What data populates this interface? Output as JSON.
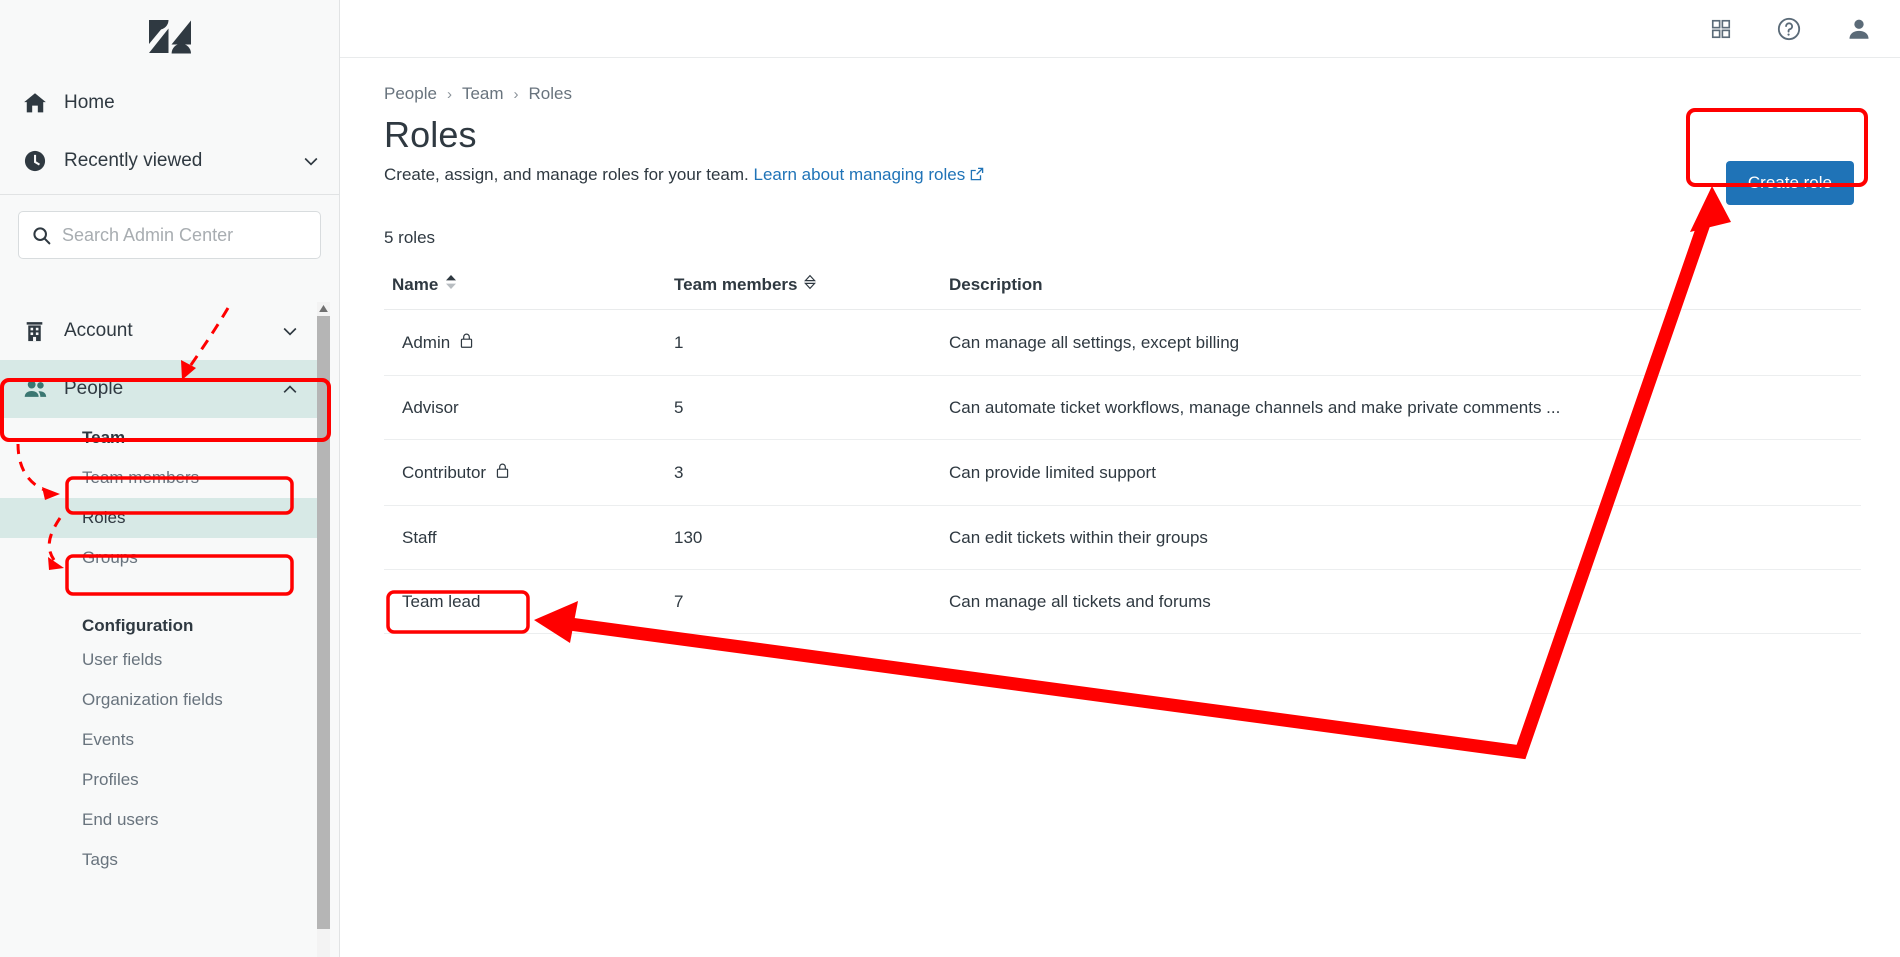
{
  "brand": {
    "logo_icon": "zendesk-logo"
  },
  "sidebar": {
    "top_items": [
      {
        "label": "Home",
        "icon": "home-icon",
        "chevron": false
      },
      {
        "label": "Recently viewed",
        "icon": "clock-icon",
        "chevron": true
      }
    ],
    "search": {
      "placeholder": "Search Admin Center",
      "value": "",
      "icon": "search-icon"
    },
    "sections": [
      {
        "label": "Account",
        "icon": "building-icon",
        "expanded": false,
        "active": false
      },
      {
        "label": "People",
        "icon": "people-icon",
        "expanded": true,
        "active": true
      }
    ],
    "people_children": [
      {
        "label": "Team",
        "style": "bold",
        "active": false
      },
      {
        "label": "Team members",
        "style": "normal",
        "active": false
      },
      {
        "label": "Roles",
        "style": "normal",
        "active": true
      },
      {
        "label": "Groups",
        "style": "normal",
        "active": false
      }
    ],
    "configuration_heading": "Configuration",
    "configuration_items": [
      {
        "label": "User fields"
      },
      {
        "label": "Organization fields"
      },
      {
        "label": "Events"
      },
      {
        "label": "Profiles"
      },
      {
        "label": "End users"
      },
      {
        "label": "Tags"
      }
    ]
  },
  "topbar": {
    "icons": [
      {
        "name": "apps-grid-icon"
      },
      {
        "name": "help-circle-icon"
      },
      {
        "name": "user-avatar-icon"
      }
    ]
  },
  "breadcrumb": {
    "items": [
      "People",
      "Team",
      "Roles"
    ],
    "separator": "›"
  },
  "header": {
    "title": "Roles",
    "subtitle_text": "Create, assign, and manage roles for your team.",
    "link_text": "Learn about managing roles",
    "link_icon": "external-link-icon"
  },
  "toolbar": {
    "create_role_label": "Create role"
  },
  "table": {
    "count_label": "5 roles",
    "columns": [
      {
        "label": "Name",
        "sort": "active",
        "sort_icon": "sort-arrows-filled"
      },
      {
        "label": "Team members",
        "sort": "inactive",
        "sort_icon": "sort-arrows-outline"
      },
      {
        "label": "Description",
        "sort": "none"
      }
    ],
    "rows": [
      {
        "name": "Admin",
        "locked": true,
        "members": "1",
        "description": "Can manage all settings, except billing"
      },
      {
        "name": "Advisor",
        "locked": false,
        "members": "5",
        "description": "Can automate ticket workflows, manage channels and make private comments ..."
      },
      {
        "name": "Contributor",
        "locked": true,
        "members": "3",
        "description": "Can provide limited support"
      },
      {
        "name": "Staff",
        "locked": false,
        "members": "130",
        "description": "Can edit tickets within their groups"
      },
      {
        "name": "Team lead",
        "locked": false,
        "members": "7",
        "description": "Can manage all tickets and forums"
      }
    ]
  },
  "annotations": {
    "highlight_color": "#ff0000",
    "boxes": [
      {
        "name": "people-nav-highlight"
      },
      {
        "name": "team-nav-highlight"
      },
      {
        "name": "roles-nav-highlight"
      },
      {
        "name": "team-lead-row-highlight"
      },
      {
        "name": "create-role-button-highlight"
      }
    ],
    "arrows": [
      {
        "name": "arrow-to-people"
      },
      {
        "name": "arrow-to-team"
      },
      {
        "name": "arrow-to-roles"
      },
      {
        "name": "arrow-to-team-lead-and-create-role"
      }
    ]
  },
  "colors": {
    "accent_blue": "#1f73b7",
    "active_nav_bg": "#d7e9e6",
    "active_nav_icon": "#3a7671",
    "text_primary": "#2f3941",
    "text_muted": "#68737d",
    "annotation_red": "#ff0000"
  }
}
